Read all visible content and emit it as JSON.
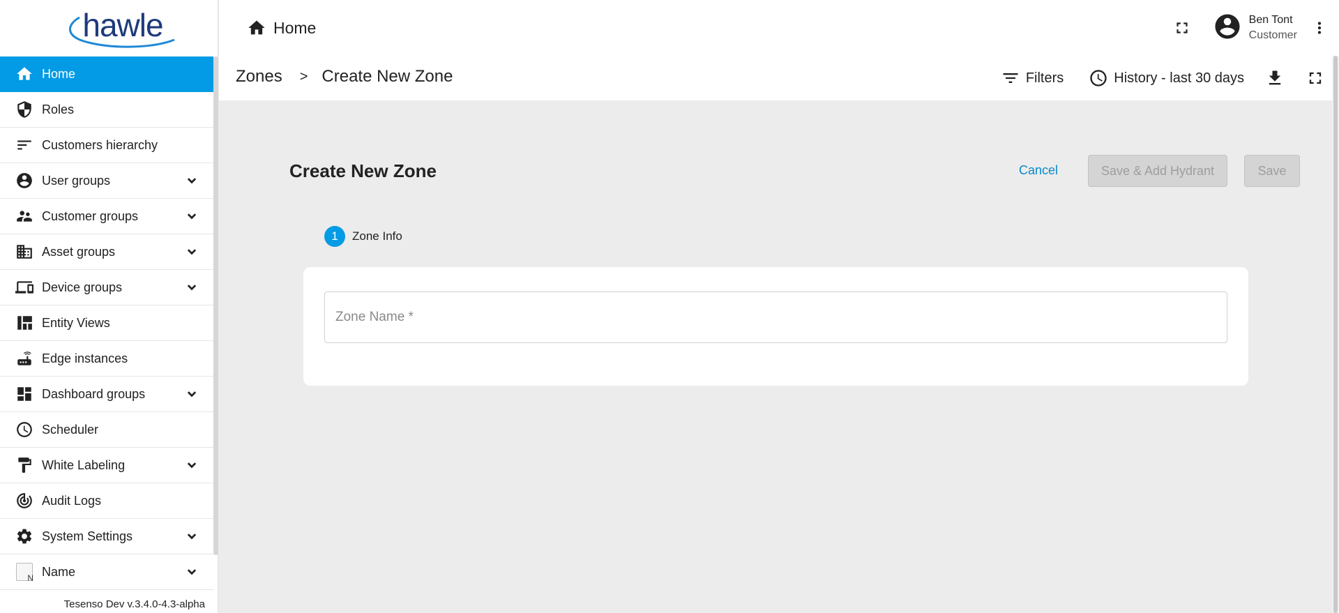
{
  "logo": {
    "text": "hawle"
  },
  "sidebar": {
    "items": [
      {
        "label": "Home",
        "icon": "home-icon",
        "active": true,
        "expandable": false
      },
      {
        "label": "Roles",
        "icon": "shield-icon",
        "expandable": false
      },
      {
        "label": "Customers hierarchy",
        "icon": "sort-icon",
        "expandable": false
      },
      {
        "label": "User groups",
        "icon": "account-circle-icon",
        "expandable": true
      },
      {
        "label": "Customer groups",
        "icon": "supervisor-icon",
        "expandable": true
      },
      {
        "label": "Asset groups",
        "icon": "domain-icon",
        "expandable": true
      },
      {
        "label": "Device groups",
        "icon": "devices-icon",
        "expandable": true
      },
      {
        "label": "Entity Views",
        "icon": "view-quilt-icon",
        "expandable": false
      },
      {
        "label": "Edge instances",
        "icon": "router-icon",
        "expandable": false
      },
      {
        "label": "Dashboard groups",
        "icon": "dashboard-icon",
        "expandable": true
      },
      {
        "label": "Scheduler",
        "icon": "clock-icon",
        "expandable": false
      },
      {
        "label": "White Labeling",
        "icon": "format-paint-icon",
        "expandable": true
      },
      {
        "label": "Audit Logs",
        "icon": "track-changes-icon",
        "expandable": false
      },
      {
        "label": "System Settings",
        "icon": "gear-icon",
        "expandable": true
      },
      {
        "label": "Name",
        "icon": "broken-image-icon",
        "expandable": true
      }
    ],
    "version": "Tesenso Dev v.3.4.0-4.3-alpha"
  },
  "topbar": {
    "home_label": "Home",
    "user_name": "Ben Tont",
    "user_role": "Customer"
  },
  "subbar": {
    "breadcrumb_parent": "Zones",
    "breadcrumb_sep": ">",
    "breadcrumb_current": "Create New Zone",
    "filters_label": "Filters",
    "history_label": "History - last 30 days"
  },
  "form": {
    "title": "Create New Zone",
    "cancel_label": "Cancel",
    "save_add_label": "Save & Add Hydrant",
    "save_label": "Save",
    "step_number": "1",
    "step_label": "Zone Info",
    "zone_name_placeholder": "Zone Name *",
    "zone_name_value": ""
  },
  "colors": {
    "accent": "#039be5",
    "link": "#0b87c9",
    "background": "#ececec"
  }
}
